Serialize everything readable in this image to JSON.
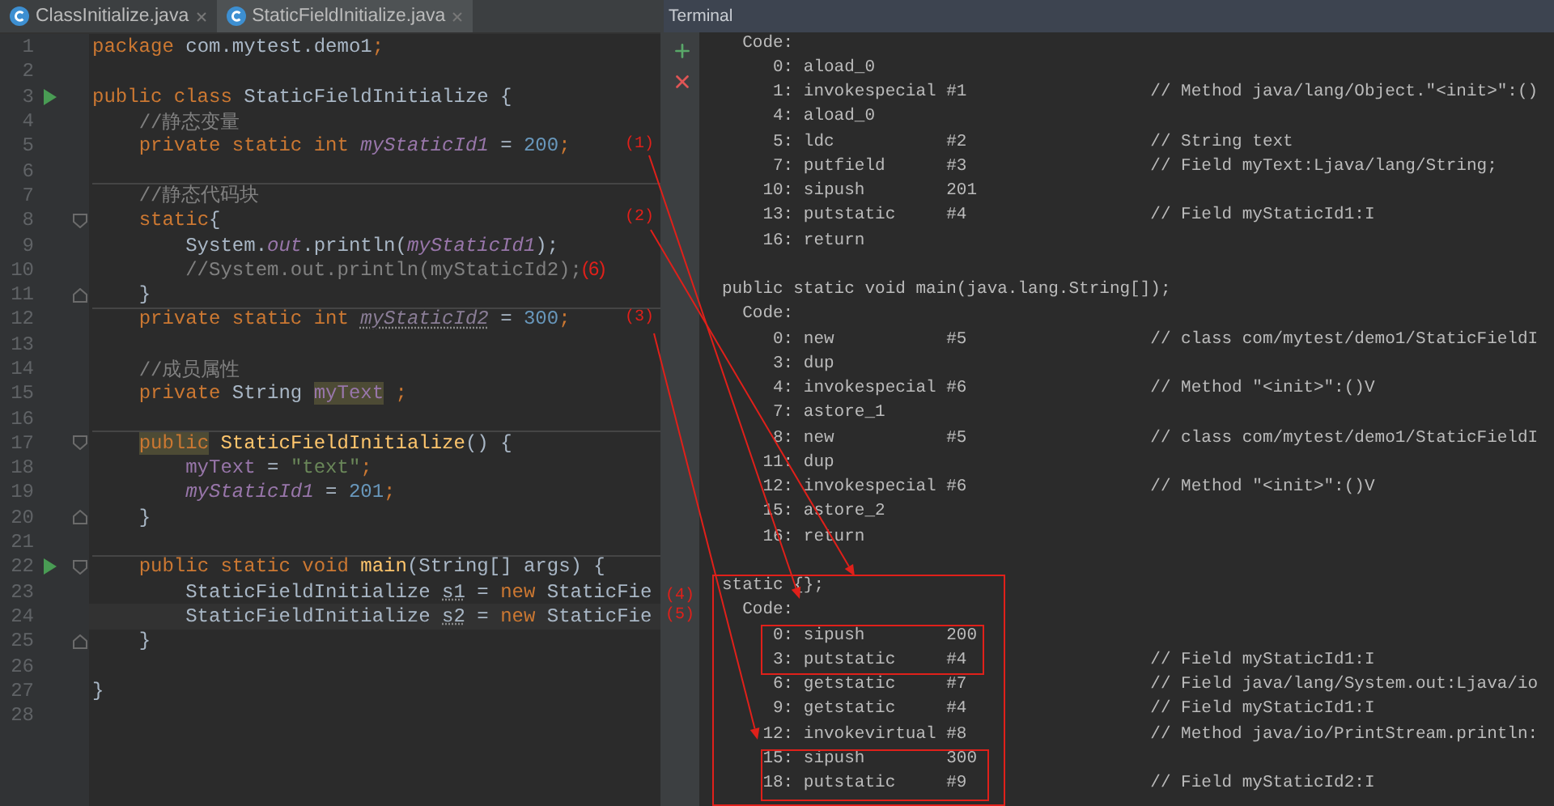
{
  "editor": {
    "tabs": [
      {
        "label": "ClassInitialize.java",
        "selected": false
      },
      {
        "label": "StaticFieldInitialize.java",
        "selected": true
      }
    ],
    "lines": [
      {
        "number": "1",
        "tokens": [
          {
            "kind": "kw",
            "text": "package"
          },
          {
            "kind": "plain",
            "text": " com.mytest.demo1"
          },
          {
            "kind": "kw",
            "text": ";"
          }
        ]
      },
      {
        "number": "2"
      },
      {
        "number": "3",
        "run": true,
        "tokens": [
          {
            "kind": "kw",
            "text": "public class "
          },
          {
            "kind": "plain",
            "text": "StaticFieldInitialize {"
          }
        ]
      },
      {
        "number": "4",
        "tokens": [
          {
            "kind": "comment",
            "text": "    //静态变量"
          }
        ]
      },
      {
        "number": "5",
        "tokens": [
          {
            "kind": "kw",
            "text": "    private static int "
          },
          {
            "kind": "static",
            "text": "myStaticId1"
          },
          {
            "kind": "plain",
            "text": " = "
          },
          {
            "kind": "num",
            "text": "200"
          },
          {
            "kind": "kw",
            "text": ";"
          }
        ]
      },
      {
        "number": "6"
      },
      {
        "number": "7",
        "separator": true,
        "tokens": [
          {
            "kind": "comment",
            "text": "    //静态代码块"
          }
        ]
      },
      {
        "number": "8",
        "fold_start": true,
        "tokens": [
          {
            "kind": "kw",
            "text": "    static"
          },
          {
            "kind": "plain",
            "text": "{"
          }
        ]
      },
      {
        "number": "9",
        "tokens": [
          {
            "kind": "plain",
            "text": "        System."
          },
          {
            "kind": "static",
            "text": "out"
          },
          {
            "kind": "plain",
            "text": ".println("
          },
          {
            "kind": "static",
            "text": "myStaticId1"
          },
          {
            "kind": "plain",
            "text": ");"
          }
        ]
      },
      {
        "number": "10",
        "tokens": [
          {
            "kind": "comment",
            "text": "        //System.out.println(myStaticId2);"
          },
          {
            "kind": "mark",
            "text": "(6)"
          }
        ]
      },
      {
        "number": "11",
        "fold_end": true,
        "tokens": [
          {
            "kind": "plain",
            "text": "    }"
          }
        ]
      },
      {
        "number": "12",
        "separator": true,
        "tokens": [
          {
            "kind": "kw",
            "text": "    private static int "
          },
          {
            "kind": "unused-static",
            "text": "myStaticId2"
          },
          {
            "kind": "plain",
            "text": " = "
          },
          {
            "kind": "num",
            "text": "300"
          },
          {
            "kind": "kw",
            "text": ";"
          }
        ]
      },
      {
        "number": "13"
      },
      {
        "number": "14",
        "tokens": [
          {
            "kind": "comment",
            "text": "    //成员属性"
          }
        ]
      },
      {
        "number": "15",
        "tokens": [
          {
            "kind": "kw",
            "text": "    private "
          },
          {
            "kind": "plain",
            "text": "String "
          },
          {
            "kind": "usage",
            "text": "myText"
          },
          {
            "kind": "kw",
            "text": " ;"
          }
        ]
      },
      {
        "number": "16"
      },
      {
        "number": "17",
        "separator": true,
        "fold_start": true,
        "tokens": [
          {
            "kind": "kw-usage",
            "text": "    public"
          },
          {
            "kind": "decl",
            "text": " StaticFieldInitialize"
          },
          {
            "kind": "plain",
            "text": "() {"
          }
        ]
      },
      {
        "number": "18",
        "tokens": [
          {
            "kind": "field",
            "text": "        myText"
          },
          {
            "kind": "plain",
            "text": " = "
          },
          {
            "kind": "str",
            "text": "\"text\""
          },
          {
            "kind": "kw",
            "text": ";"
          }
        ]
      },
      {
        "number": "19",
        "tokens": [
          {
            "kind": "static",
            "text": "        myStaticId1"
          },
          {
            "kind": "plain",
            "text": " = "
          },
          {
            "kind": "num",
            "text": "201"
          },
          {
            "kind": "kw",
            "text": ";"
          }
        ]
      },
      {
        "number": "20",
        "fold_end": true,
        "tokens": [
          {
            "kind": "plain",
            "text": "    }"
          }
        ]
      },
      {
        "number": "21"
      },
      {
        "number": "22",
        "separator": true,
        "run": true,
        "fold_start": true,
        "tokens": [
          {
            "kind": "kw",
            "text": "    public static void "
          },
          {
            "kind": "decl",
            "text": "main"
          },
          {
            "kind": "plain",
            "text": "(String[] args) {"
          }
        ]
      },
      {
        "number": "23",
        "tokens": [
          {
            "kind": "plain",
            "text": "        StaticFieldInitialize "
          },
          {
            "kind": "unused",
            "text": "s1"
          },
          {
            "kind": "plain",
            "text": " = "
          },
          {
            "kind": "kw",
            "text": "new"
          },
          {
            "kind": "plain",
            "text": " StaticFie"
          }
        ]
      },
      {
        "number": "24",
        "current": true,
        "tokens": [
          {
            "kind": "plain",
            "text": "        StaticFieldInitialize "
          },
          {
            "kind": "unused",
            "text": "s2"
          },
          {
            "kind": "plain",
            "text": " = "
          },
          {
            "kind": "kw",
            "text": "new"
          },
          {
            "kind": "plain",
            "text": " StaticFie"
          }
        ]
      },
      {
        "number": "25",
        "fold_end": true,
        "tokens": [
          {
            "kind": "plain",
            "text": "    }"
          }
        ]
      },
      {
        "number": "26"
      },
      {
        "number": "27",
        "tokens": [
          {
            "kind": "plain",
            "text": "}"
          }
        ]
      },
      {
        "number": "28"
      }
    ]
  },
  "terminal": {
    "title": "Terminal",
    "blocks": [
      {
        "lines": [
          "  Code:",
          "     0: aload_0",
          "     1: invokespecial #1                  // Method java/lang/Object.\"<init>\":()",
          "     4: aload_0",
          "     5: ldc           #2                  // String text",
          "     7: putfield      #3                  // Field myText:Ljava/lang/String;",
          "    10: sipush        201",
          "    13: putstatic     #4                  // Field myStaticId1:I",
          "    16: return"
        ]
      },
      {
        "lines": [
          "public static void main(java.lang.String[]);",
          "  Code:",
          "     0: new           #5                  // class com/mytest/demo1/StaticFieldI",
          "     3: dup",
          "     4: invokespecial #6                  // Method \"<init>\":()V",
          "     7: astore_1",
          "     8: new           #5                  // class com/mytest/demo1/StaticFieldI",
          "    11: dup",
          "    12: invokespecial #6                  // Method \"<init>\":()V",
          "    15: astore_2",
          "    16: return"
        ]
      },
      {
        "lines": [
          "static {};",
          "  Code:",
          "     0: sipush        200",
          "     3: putstatic     #4                  // Field myStaticId1:I",
          "     6: getstatic     #7                  // Field java/lang/System.out:Ljava/io",
          "     9: getstatic     #4                  // Field myStaticId1:I",
          "    12: invokevirtual #8                  // Method java/io/PrintStream.println:",
          "    15: sipush        300",
          "    18: putstatic     #9                  // Field myStaticId2:I"
        ]
      }
    ]
  },
  "annotations": [
    "(1)",
    "(2)",
    "(3)",
    "(4)",
    "(5)"
  ]
}
